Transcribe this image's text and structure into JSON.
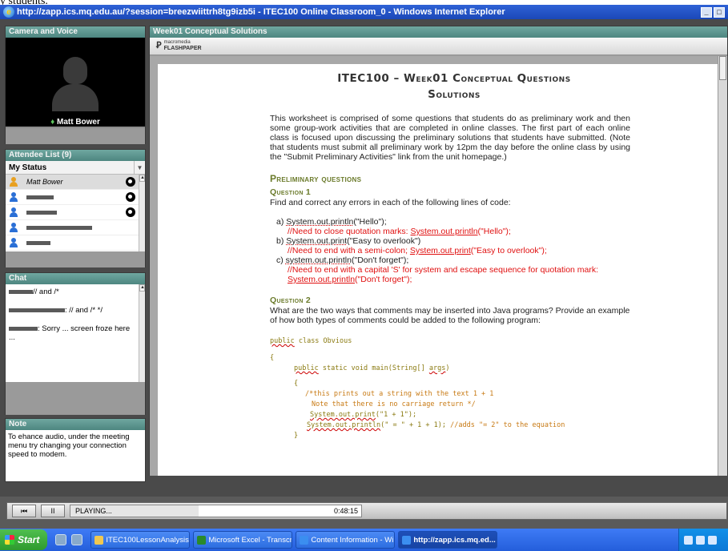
{
  "caption": "y students.",
  "window": {
    "title": "http://zapp.ics.mq.edu.au/?session=breezwiittrh8tg9izb5i - ITEC100 Online Classroom_0 - Windows Internet Explorer",
    "ie_icon": "e",
    "minimize": "_",
    "maximize": "□"
  },
  "camera": {
    "header": "Camera and Voice",
    "presenter": "Matt Bower",
    "icon": "person-silhouette"
  },
  "attendees": {
    "header": "Attendee List (9)",
    "status_label": "My Status",
    "rows": [
      {
        "name": "Matt Bower",
        "icon_color": "#e8a020",
        "mic": true,
        "selected": true
      },
      {
        "name": "",
        "icon_color": "#2a6fd6",
        "mic": true,
        "redact_w": 34
      },
      {
        "name": "",
        "icon_color": "#2a6fd6",
        "mic": true,
        "redact_w": 38
      },
      {
        "name": "",
        "icon_color": "#2a6fd6",
        "mic": false,
        "redact_w": 82
      },
      {
        "name": "",
        "icon_color": "#2a6fd6",
        "mic": false,
        "redact_w": 30
      }
    ]
  },
  "chat": {
    "header": "Chat",
    "messages": [
      {
        "text": "// and /*"
      },
      {
        "text": ": // and /* */"
      },
      {
        "text": ": Sorry ... screen froze here ..."
      }
    ]
  },
  "note": {
    "header": "Note",
    "text": "To ehance audio, under the meeting menu try changing your connection speed to modem."
  },
  "share": {
    "header": "Week01 Conceptual Solutions",
    "logo_small": "macromedia",
    "logo_big": "FLASHPAPER"
  },
  "doc": {
    "title_line1": "ITEC100 – Week01 Conceptual Questions",
    "title_line2": "Solutions",
    "intro": "This worksheet is comprised of some questions that students do as preliminary work and then some group-work activities that are completed in online classes. The first part of each online class is focused upon discussing the preliminary solutions that students have submitted. (Note that students must submit all preliminary work by 12pm the day before the online class by using the \"Submit Preliminary Activities\" link from the unit homepage.)",
    "section": "Preliminary questions",
    "q1_title": "Question 1",
    "q1_text": "Find and correct any errors in each of the following lines of code:",
    "q1_items": [
      {
        "label": "a)",
        "code_ul": "System.out.println",
        "code_rest": "(\"Hello\");",
        "fix_pre": "//Need to close quotation marks: ",
        "fix_ul": "System.out.println",
        "fix_post": "(\"Hello\");"
      },
      {
        "label": "b)",
        "code_ul": "System.out.print",
        "code_rest": "(\"Easy to overlook\")",
        "fix_pre": "//Need to end with a semi-colon; ",
        "fix_ul": "System.out.print",
        "fix_post": "(\"Easy to overlook\");"
      },
      {
        "label": "c)",
        "code_ul": "system.out.println",
        "code_rest": "(\"Don't forget\");",
        "fix_pre": "//Need to end with a capital 'S' for system and escape sequence for quotation mark: ",
        "fix_ul": "System.out.println",
        "fix_post": "(\"Don't forget\");"
      }
    ],
    "q2_title": "Question 2",
    "q2_text": "What are the two ways that comments may be inserted into Java programs? Provide an example of how both types of comments could be added to the following program:",
    "code": {
      "l1a": "public",
      "l1b": " class Obvious",
      "l2": "{",
      "l3a": "public",
      "l3b": " static void main(String[] ",
      "l3c": "args",
      "l3d": ")",
      "l4": "{",
      "l5": "/*this prints out a string with the text 1 + 1",
      "l6": "Note that there is no carriage return */",
      "l7a": "System.out.print",
      "l7b": "(\"1 + 1\");",
      "l8a": "System.out.println",
      "l8b": "(\" = \" + 1 + 1);  ",
      "l8c": "//adds \"= 2\" to the equation",
      "l9": "}"
    }
  },
  "playback": {
    "status": "PLAYING...",
    "time": "0:48:15",
    "pause": "II",
    "rewind": "⏮",
    "progress": 0.44
  },
  "taskbar": {
    "start": "Start",
    "tasks": [
      {
        "label": "ITEC100LessonAnalysis",
        "color": "#f0c850"
      },
      {
        "label": "Microsoft Excel - Transcri...",
        "color": "#2a8a2a"
      },
      {
        "label": "Content Information - Wi...",
        "color": "#3b8ef0"
      },
      {
        "label": "http://zapp.ics.mq.ed...",
        "color": "#3b8ef0",
        "active": true
      }
    ]
  }
}
